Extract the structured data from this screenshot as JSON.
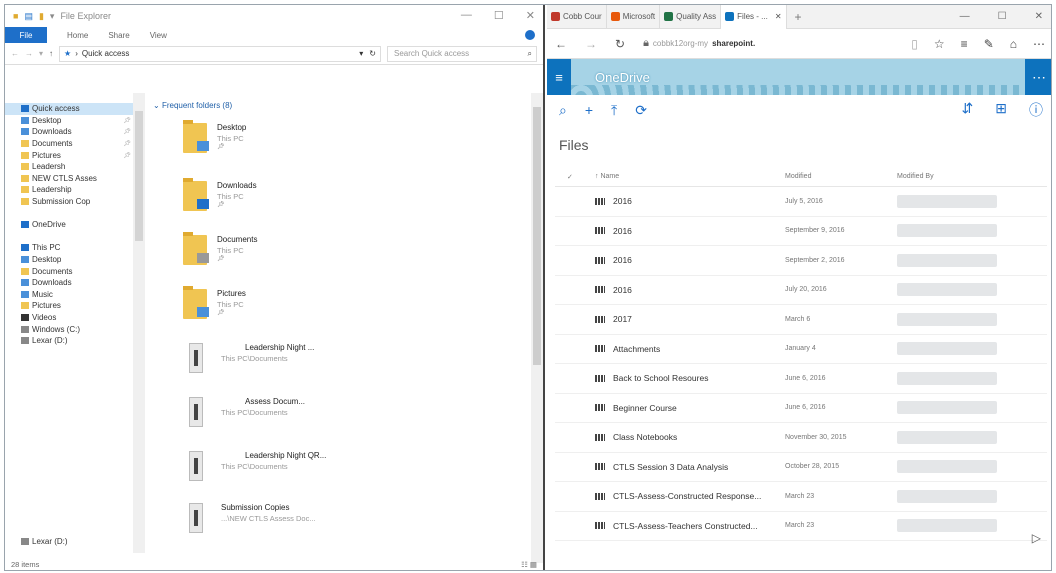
{
  "explorer": {
    "title": "File Explorer",
    "ribbon": {
      "file": "File",
      "home": "Home",
      "share": "Share",
      "view": "View"
    },
    "address": {
      "crumb": "Quick access",
      "search_placeholder": "Search Quick access"
    },
    "nav": [
      {
        "label": "Quick access",
        "sel": true,
        "color": "#1e6fc9"
      },
      {
        "label": "Desktop",
        "pin": true,
        "color": "#4a90d9"
      },
      {
        "label": "Downloads",
        "pin": true,
        "color": "#4a90d9"
      },
      {
        "label": "Documents",
        "pin": true,
        "color": "#f0c552"
      },
      {
        "label": "Pictures",
        "pin": true,
        "color": "#f0c552"
      },
      {
        "label": "Leadersh",
        "color": "#f0c552"
      },
      {
        "label": "NEW CTLS Asses",
        "color": "#f0c552"
      },
      {
        "label": "Leadership",
        "color": "#f0c552"
      },
      {
        "label": "Submission Cop",
        "color": "#f0c552"
      },
      {
        "label": "",
        "color": ""
      },
      {
        "label": "OneDrive",
        "color": "#1e6fc9"
      },
      {
        "label": "",
        "color": ""
      },
      {
        "label": "This PC",
        "color": "#1e6fc9"
      },
      {
        "label": "Desktop",
        "color": "#4a90d9"
      },
      {
        "label": "Documents",
        "color": "#f0c552"
      },
      {
        "label": "Downloads",
        "color": "#4a90d9"
      },
      {
        "label": "Music",
        "color": "#4a90d9"
      },
      {
        "label": "Pictures",
        "color": "#f0c552"
      },
      {
        "label": "Videos",
        "color": "#333"
      },
      {
        "label": "Windows (C:)",
        "color": "#888"
      },
      {
        "label": "Lexar (D:)",
        "color": "#888"
      }
    ],
    "nav_bottom": "Lexar (D:)",
    "group_label": "Frequent folders (8)",
    "folders": [
      {
        "name": "Desktop",
        "sub": "This PC"
      },
      {
        "name": "Downloads",
        "sub": "This PC"
      },
      {
        "name": "Documents",
        "sub": "This PC"
      },
      {
        "name": "Pictures",
        "sub": "This PC"
      },
      {
        "name": "Leadership Night ...",
        "sub": "This PC\\Documents"
      },
      {
        "name": "Assess Docum...",
        "sub": "This PC\\Documents"
      },
      {
        "name": "Leadership Night QR...",
        "sub": "This PC\\Documents"
      },
      {
        "name": "Submission Copies",
        "sub": "...\\NEW CTLS Assess Doc..."
      }
    ],
    "status": "28 items"
  },
  "browser": {
    "tabs": [
      {
        "label": "Cobb Cour",
        "color": "#c0392b"
      },
      {
        "label": "Microsoft",
        "color": "#e8590c"
      },
      {
        "label": "Quality Ass",
        "color": "#217346"
      },
      {
        "label": "Files - ...",
        "color": "#0d72bd",
        "active": true
      }
    ],
    "url_prefix": "cobbk12org-my",
    "url_domain": "sharepoint."
  },
  "onedrive": {
    "brand": "OneDrive",
    "heading": "Files",
    "columns": {
      "name": "Name",
      "modified": "Modified",
      "modified_by": "Modified By"
    },
    "files": [
      {
        "name": "2016",
        "modified": "July 5, 2016"
      },
      {
        "name": "2016",
        "modified": "September 9, 2016"
      },
      {
        "name": "2016",
        "modified": "September 2, 2016"
      },
      {
        "name": "2016",
        "modified": "July 20, 2016"
      },
      {
        "name": "2017",
        "modified": "March 6"
      },
      {
        "name": "Attachments",
        "modified": "January 4"
      },
      {
        "name": "Back to School Resoures",
        "modified": "June 6, 2016"
      },
      {
        "name": "Beginner Course",
        "modified": "June 6, 2016"
      },
      {
        "name": "Class Notebooks",
        "modified": "November 30, 2015"
      },
      {
        "name": "CTLS Session 3 Data Analysis",
        "modified": "October 28, 2015"
      },
      {
        "name": "CTLS-Assess-Constructed Response...",
        "modified": "March 23"
      },
      {
        "name": "CTLS-Assess-Teachers Constructed...",
        "modified": "March 23"
      }
    ]
  }
}
